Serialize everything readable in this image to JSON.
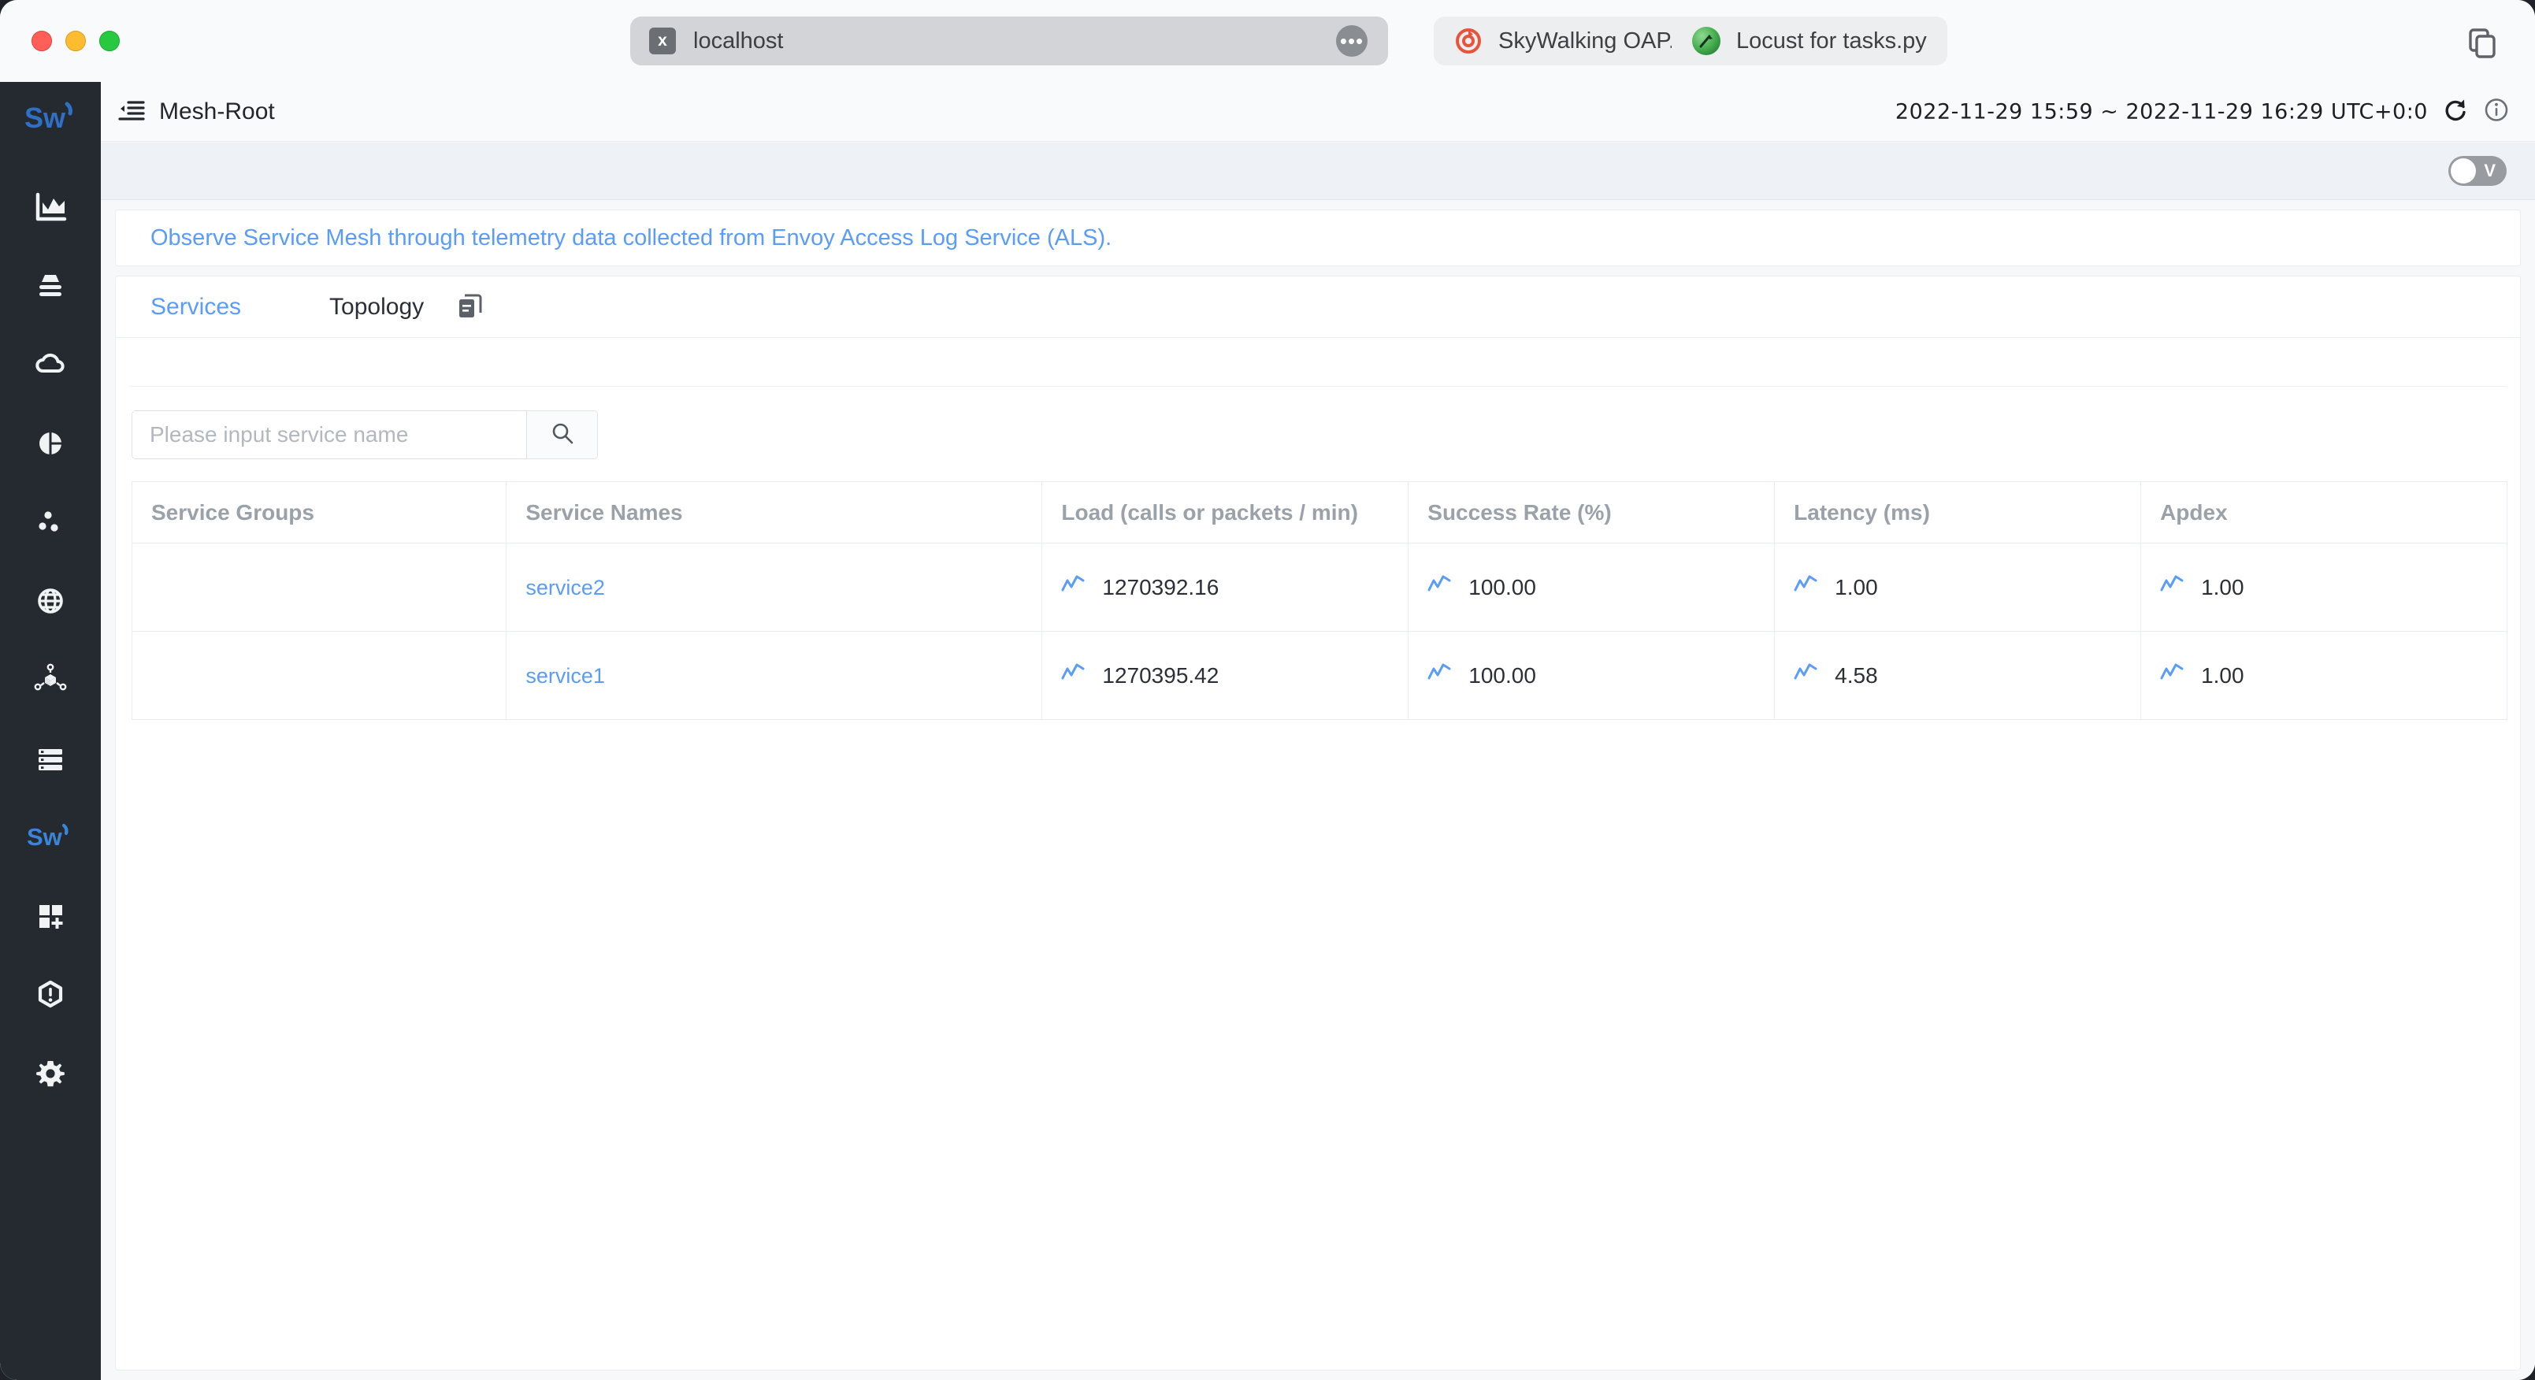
{
  "browser": {
    "tabs": [
      {
        "title": "localhost",
        "icon": "x-favicon",
        "active": true
      },
      {
        "title": "SkyWalking OAP...",
        "icon": "skywalking-favicon",
        "active": false
      },
      {
        "title": "Locust for tasks.py",
        "icon": "locust-favicon",
        "active": false
      }
    ],
    "tab_overview_icon": "tab-overview-icon",
    "tab_menu_icon": "ellipsis-icon"
  },
  "header": {
    "breadcrumb_icon": "menu-collapse-icon",
    "breadcrumb": "Mesh-Root",
    "time_range": "2022-11-29 15:59 ~ 2022-11-29 16:29  UTC+0:0",
    "refresh_icon": "refresh-icon",
    "info_icon": "info-icon"
  },
  "toolbar": {
    "version_toggle_label": "V",
    "version_toggle_on": false
  },
  "sidebar": {
    "logo": "skywalking-logo",
    "items": [
      {
        "name": "general-service",
        "icon": "chart-icon",
        "active": false
      },
      {
        "name": "database",
        "icon": "database-icon",
        "active": false
      },
      {
        "name": "virtual-machine",
        "icon": "cloud-icon",
        "active": false
      },
      {
        "name": "kubernetes",
        "icon": "pie-chart-icon",
        "active": false
      },
      {
        "name": "service-mesh",
        "icon": "mesh-dots-icon",
        "active": false
      },
      {
        "name": "browser",
        "icon": "globe-icon",
        "active": false
      },
      {
        "name": "infrastructure",
        "icon": "topology-cube-icon",
        "active": false
      },
      {
        "name": "logs",
        "icon": "server-list-icon",
        "active": false
      },
      {
        "name": "self-observability",
        "icon": "skywalking-icon",
        "active": true
      },
      {
        "name": "dashboards",
        "icon": "grid-plus-icon",
        "active": false
      },
      {
        "name": "alarm",
        "icon": "alarm-hexagon-icon",
        "active": false
      },
      {
        "name": "settings",
        "icon": "gear-icon",
        "active": false
      }
    ]
  },
  "main": {
    "banner": "Observe Service Mesh through telemetry data collected from Envoy Access Log Service (ALS).",
    "tabs": [
      {
        "label": "Services",
        "selected": true
      },
      {
        "label": "Topology",
        "selected": false
      }
    ],
    "tabbar_icon": "copy-dashboard-icon",
    "search": {
      "placeholder": "Please input service name",
      "value": "",
      "button_icon": "search-icon"
    },
    "table": {
      "columns": [
        "Service Groups",
        "Service Names",
        "Load (calls or packets / min)",
        "Success Rate (%)",
        "Latency (ms)",
        "Apdex"
      ],
      "rows": [
        {
          "group": "",
          "service": "service2",
          "load": "1270392.16",
          "success_rate": "100.00",
          "latency": "1.00",
          "apdex": "1.00"
        },
        {
          "group": "",
          "service": "service1",
          "load": "1270395.42",
          "success_rate": "100.00",
          "latency": "4.58",
          "apdex": "1.00"
        }
      ],
      "metric_icon": "trend-line-icon"
    }
  },
  "colors": {
    "accent": "#5a9cf8",
    "sidebar_bg": "#252a31",
    "page_bg": "#f6f8fa",
    "header_muted": "#9aa1a9"
  }
}
